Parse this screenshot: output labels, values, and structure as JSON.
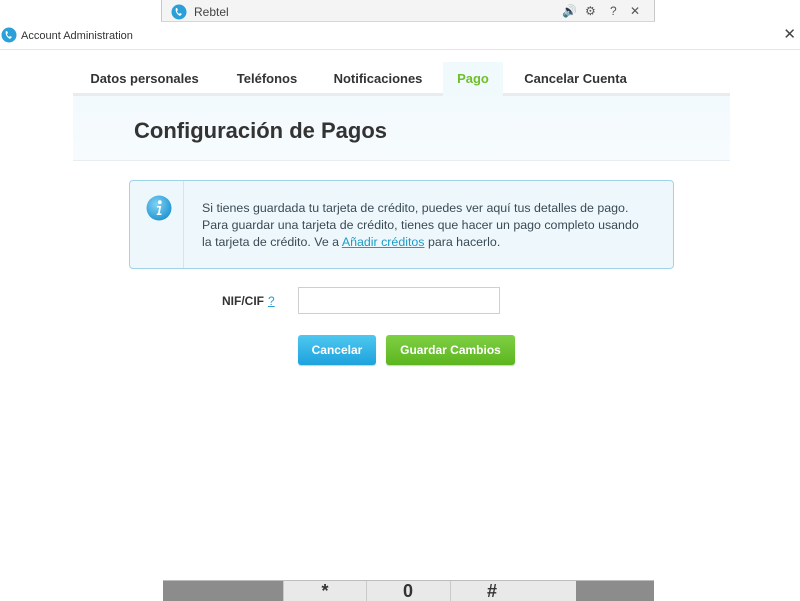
{
  "background_window": {
    "title": "Rebtel",
    "controls": [
      "🔊",
      "⚙",
      "?",
      "✕"
    ]
  },
  "dialog": {
    "title": "Account Administration",
    "close": "✕"
  },
  "tabs": [
    {
      "label": "Datos personales"
    },
    {
      "label": "Teléfonos"
    },
    {
      "label": "Notificaciones"
    },
    {
      "label": "Pago",
      "active": true
    },
    {
      "label": "Cancelar Cuenta"
    }
  ],
  "section": {
    "heading": "Configuración de Pagos"
  },
  "info": {
    "text_before_link": "Si tienes guardada tu tarjeta de crédito, puedes ver aquí tus detalles de pago. Para guardar una tarjeta de crédito, tienes que hacer un pago completo usando la tarjeta de crédito. Ve a ",
    "link": "Añadir créditos",
    "text_after_link": " para hacerlo."
  },
  "form": {
    "nif_label": "NIF/CIF",
    "nif_help": "?",
    "nif_value": ""
  },
  "buttons": {
    "cancel": "Cancelar",
    "save": "Guardar Cambios"
  },
  "dialpad": {
    "keys": [
      "*",
      "0",
      "#"
    ]
  },
  "colors": {
    "accent_green": "#6fbf2a",
    "accent_blue": "#1da2dc",
    "info_border": "#9fd4e8"
  }
}
